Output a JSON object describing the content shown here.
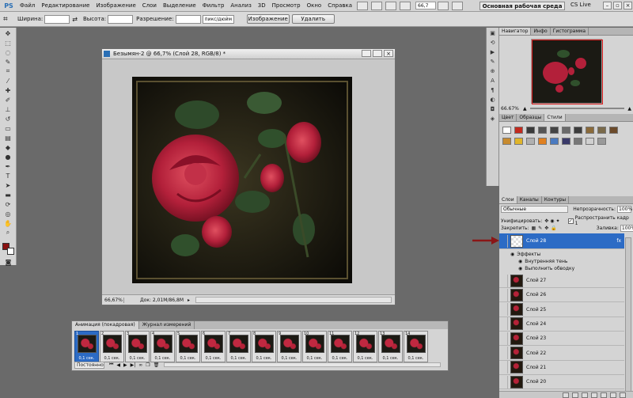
{
  "app": {
    "logo": "PS",
    "workspace": "Основная рабочая среда",
    "cs_live": "CS Live",
    "zoom": "66,7"
  },
  "menu": [
    "Файл",
    "Редактирование",
    "Изображение",
    "Слои",
    "Выделение",
    "Фильтр",
    "Анализ",
    "3D",
    "Просмотр",
    "Окно",
    "Справка"
  ],
  "options": {
    "width_label": "Ширина:",
    "height_label": "Высота:",
    "resolution_label": "Разрешение:",
    "width_value": "",
    "height_value": "",
    "resolution_value": "",
    "unit": "пикс/дюйм",
    "image_btn": "Изображение",
    "delete_btn": "Удалить"
  },
  "document": {
    "title": "Безымян-2 @ 66,7% (Слой 28, RGB/8) *",
    "zoom": "66,67%",
    "doc_info": "Док: 2,01M/86,8M"
  },
  "animation": {
    "tabs": [
      "Анимация (покадровая)",
      "Журнал измерений"
    ],
    "frames": [
      {
        "num": "1",
        "dur": "0,1 сек."
      },
      {
        "num": "2",
        "dur": "0,1 сек."
      },
      {
        "num": "3",
        "dur": "0,1 сек."
      },
      {
        "num": "4",
        "dur": "0,1 сек."
      },
      {
        "num": "5",
        "dur": "0,1 сек."
      },
      {
        "num": "6",
        "dur": "0,1 сек."
      },
      {
        "num": "7",
        "dur": "0,1 сек."
      },
      {
        "num": "8",
        "dur": "0,1 сек."
      },
      {
        "num": "9",
        "dur": "0,1 сек."
      },
      {
        "num": "10",
        "dur": "0,1 сек."
      },
      {
        "num": "11",
        "dur": "0,1 сек."
      },
      {
        "num": "12",
        "dur": "0,1 сек."
      },
      {
        "num": "13",
        "dur": "0,1 сек."
      },
      {
        "num": "14",
        "dur": "0,1 сек."
      }
    ],
    "loop": "Постоянно"
  },
  "navigator": {
    "tabs": [
      "Навигатор",
      "Инфо",
      "Гистограмма"
    ],
    "zoom": "66.67%"
  },
  "swatches": {
    "tabs": [
      "Цвет",
      "Образцы",
      "Стили"
    ],
    "colors": [
      "#ffffff",
      "#c22a1e",
      "#3a3a3a",
      "#555555",
      "#444444",
      "#6a6a6a",
      "#3c3c3c",
      "#8a6a3a",
      "#7a6a4a",
      "#6b4a2a",
      "#c78a2e",
      "#e0b52a",
      "#b0b0b0",
      "#e08020",
      "#4a7ac0",
      "#3a3a6a",
      "#777777",
      "#d0d0d0",
      "#999999"
    ]
  },
  "layers": {
    "tabs": [
      "Слои",
      "Каналы",
      "Контуры"
    ],
    "blend_mode": "Обычные",
    "opacity_label": "Непрозрачность:",
    "opacity": "100%",
    "unify_label": "Унифицировать:",
    "propagate_label": "Распространить кадр 1",
    "lock_label": "Закрепить:",
    "fill_label": "Заливка:",
    "fill": "100%",
    "selected": "Слой 28",
    "effects_label": "Эффекты",
    "effects": [
      "Внутренняя тень",
      "Выполнить обводку"
    ],
    "items": [
      "Слой 27",
      "Слой 26",
      "Слой 25",
      "Слой 24",
      "Слой 23",
      "Слой 22",
      "Слой 21",
      "Слой 20"
    ]
  }
}
